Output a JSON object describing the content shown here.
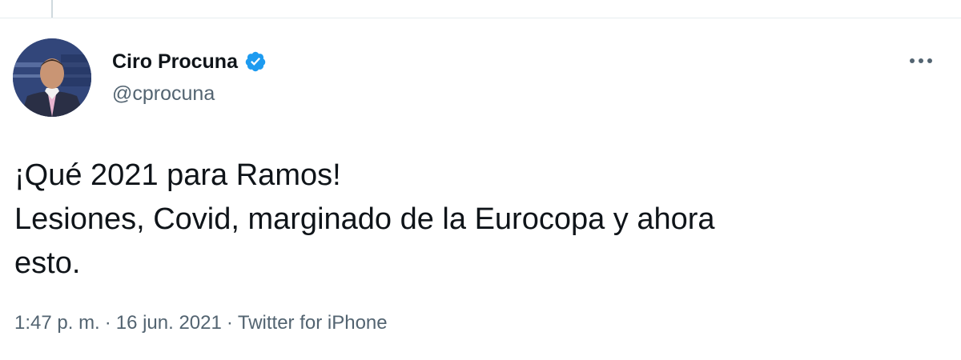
{
  "author": {
    "display_name": "Ciro Procuna",
    "handle": "@cprocuna",
    "verified": true,
    "avatar_icon": "profile-photo"
  },
  "tweet": {
    "lines": [
      "¡Qué 2021 para Ramos!",
      "Lesiones, Covid, marginado de la Eurocopa y ahora",
      "esto."
    ]
  },
  "meta": {
    "time": "1:47 p. m.",
    "separator": "·",
    "date": "16 jun. 2021",
    "source": "Twitter for iPhone"
  },
  "colors": {
    "verified": "#1d9bf0",
    "text_primary": "#0f1419",
    "text_secondary": "#536471"
  }
}
